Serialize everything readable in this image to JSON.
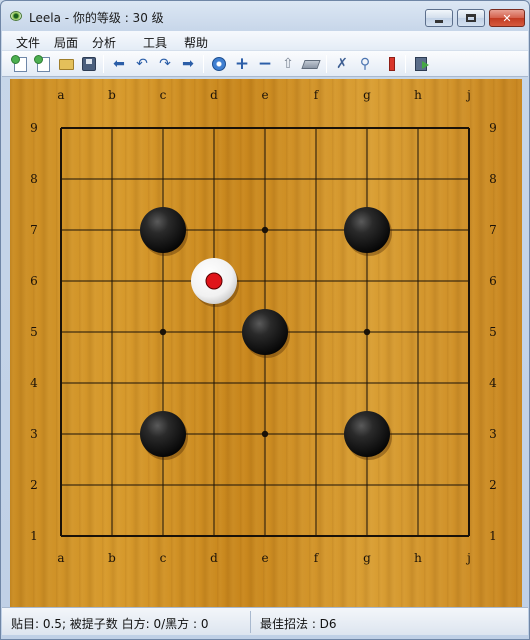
{
  "window": {
    "title": "Leela - 你的等级 : 30 级"
  },
  "menu": {
    "items": [
      "文件",
      "局面",
      "分析",
      "工具",
      "帮助"
    ]
  },
  "toolbar": {
    "icons": [
      "new-game-icon",
      "new-setup-icon",
      "open-icon",
      "save-icon",
      "back-icon",
      "undo-icon",
      "redo-icon",
      "forward-icon",
      "settings-icon",
      "add-icon",
      "remove-icon",
      "first-move-icon",
      "eraser-icon",
      "cross-icon",
      "zoom-icon",
      "bookmark-icon",
      "exit-icon"
    ]
  },
  "board": {
    "size": 9,
    "columns": [
      "a",
      "b",
      "c",
      "d",
      "e",
      "f",
      "g",
      "h",
      "j"
    ],
    "rows": [
      "9",
      "8",
      "7",
      "6",
      "5",
      "4",
      "3",
      "2",
      "1"
    ],
    "star_points": [
      "c7",
      "e7",
      "g7",
      "c5",
      "g5",
      "c3",
      "e3",
      "g3",
      "e5"
    ],
    "stones": [
      {
        "color": "black",
        "point": "c7"
      },
      {
        "color": "black",
        "point": "g7"
      },
      {
        "color": "black",
        "point": "e5"
      },
      {
        "color": "black",
        "point": "c3"
      },
      {
        "color": "black",
        "point": "g3"
      },
      {
        "color": "white",
        "point": "d6",
        "last_move": true
      }
    ],
    "colors": {
      "board": "#d4962a",
      "line": "#1a1208",
      "last_move_marker": "#e0141a"
    }
  },
  "status": {
    "left": "贴目: 0.5; 被提子数 白方: 0/黑方   : 0",
    "right": "最佳招法 : D6"
  }
}
